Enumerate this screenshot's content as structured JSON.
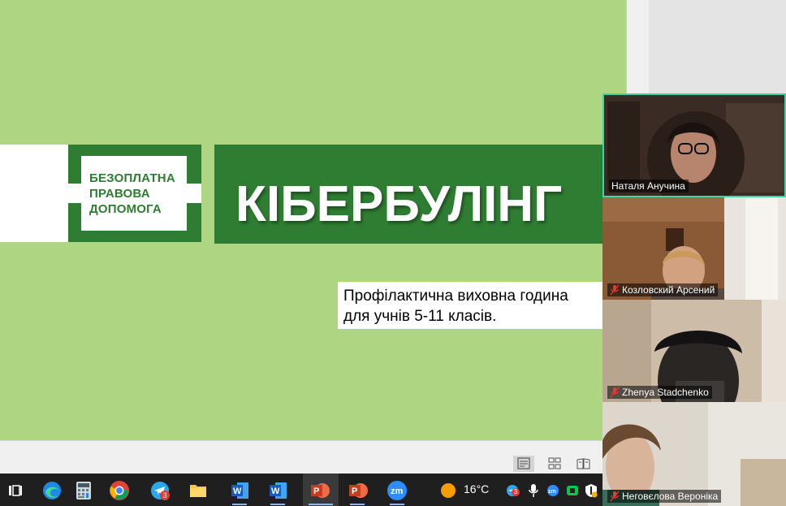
{
  "slide": {
    "logo_lines": [
      "БЕЗОПЛАТНА",
      "ПРАВОВА",
      "ДОПОМОГА"
    ],
    "title": "КІБЕРБУЛІНГ",
    "subtitle_line1": "Профілактична виховна година",
    "subtitle_line2": "для учнів 5-11 класів."
  },
  "colors": {
    "slide_bg": "#aed581",
    "brand_green": "#2e7d32",
    "active_speaker_border": "#3fd3a8"
  },
  "status_bar": {
    "views": [
      "normal-view-icon",
      "slide-sorter-icon",
      "reading-view-icon"
    ]
  },
  "taskbar": {
    "apps": [
      "task-view-icon",
      "edge-icon",
      "calculator-icon",
      "chrome-icon",
      "telegram-icon",
      "file-explorer-icon",
      "word-icon",
      "word-icon",
      "powerpoint-icon",
      "powerpoint-icon",
      "zoom-icon"
    ],
    "telegram_badge": "3",
    "tray_telegram_badge": "3",
    "temperature": "16°C"
  },
  "participants": [
    {
      "name": "Наталя Анучина",
      "muted": false,
      "active": true
    },
    {
      "name": "Козловский Арсений",
      "muted": true,
      "active": false
    },
    {
      "name": "Zhenya Stadchenko",
      "muted": true,
      "active": false
    },
    {
      "name": "Неговєлова Вероніка",
      "muted": true,
      "active": false
    }
  ]
}
